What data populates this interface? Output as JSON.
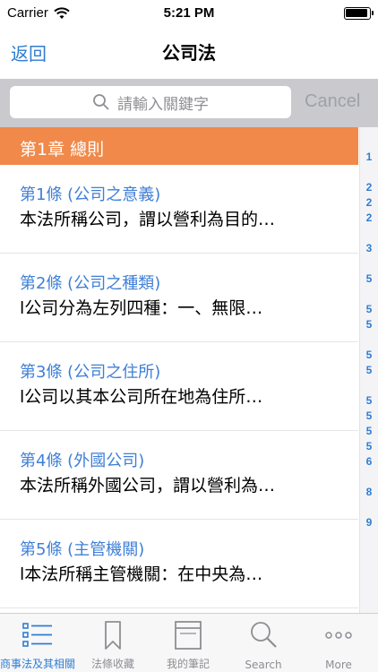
{
  "status_bar": {
    "carrier": "Carrier",
    "time": "5:21 PM"
  },
  "nav": {
    "back_label": "返回",
    "title": "公司法"
  },
  "search": {
    "placeholder": "請輸入關鍵字",
    "cancel_label": "Cancel"
  },
  "chapter": {
    "title": "第1章 總則"
  },
  "articles": [
    {
      "title": "第1條 (公司之意義)",
      "text": "本法所稱公司，謂以營利為目的…"
    },
    {
      "title": "第2條 (公司之種類)",
      "text": "l公司分為左列四種：一、無限…"
    },
    {
      "title": "第3條 (公司之住所)",
      "text": "l公司以其本公司所在地為住所…"
    },
    {
      "title": "第4條 (外國公司)",
      "text": "本法所稱外國公司，謂以營利為…"
    },
    {
      "title": "第5條 (主管機關)",
      "text": "l本法所稱主管機關：在中央為…"
    }
  ],
  "index_items": [
    "1",
    "2",
    "2",
    "2",
    "3",
    "5",
    "5",
    "5",
    "5",
    "5",
    "5",
    "5",
    "5",
    "5",
    "6",
    "8",
    "9"
  ],
  "tabs": [
    {
      "label": "商事法及其相關法規",
      "icon": "list-icon",
      "active": true
    },
    {
      "label": "法條收藏",
      "icon": "bookmark-icon",
      "active": false
    },
    {
      "label": "我的筆記",
      "icon": "notes-icon",
      "active": false
    },
    {
      "label": "Search",
      "icon": "search-icon",
      "active": false
    },
    {
      "label": "More",
      "icon": "more-icon",
      "active": false
    }
  ],
  "colors": {
    "accent": "#2f7dd3",
    "chapter_bg": "#f0894a",
    "search_bg": "#c9c9ce",
    "article_title": "#3f7fd6"
  }
}
